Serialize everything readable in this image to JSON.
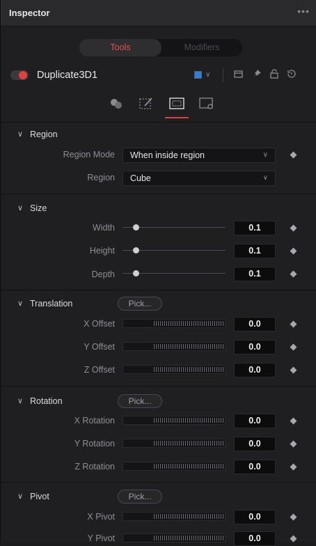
{
  "header": {
    "title": "Inspector",
    "more": "•••"
  },
  "tabs": {
    "tools": "Tools",
    "modifiers": "Modifiers"
  },
  "tool": {
    "name": "Duplicate3D1",
    "color": "#2f7fd6",
    "enabled": true
  },
  "sections": {
    "region": {
      "title": "Region",
      "region_mode_label": "Region Mode",
      "region_mode_value": "When inside region",
      "region_label": "Region",
      "region_value": "Cube"
    },
    "size": {
      "title": "Size",
      "width_label": "Width",
      "width_value": "0.1",
      "height_label": "Height",
      "height_value": "0.1",
      "depth_label": "Depth",
      "depth_value": "0.1"
    },
    "translation": {
      "title": "Translation",
      "pick": "Pick...",
      "x_label": "X Offset",
      "x_value": "0.0",
      "y_label": "Y Offset",
      "y_value": "0.0",
      "z_label": "Z Offset",
      "z_value": "0.0"
    },
    "rotation": {
      "title": "Rotation",
      "pick": "Pick...",
      "x_label": "X Rotation",
      "x_value": "0.0",
      "y_label": "Y Rotation",
      "y_value": "0.0",
      "z_label": "Z Rotation",
      "z_value": "0.0"
    },
    "pivot": {
      "title": "Pivot",
      "pick": "Pick...",
      "x_label": "X Pivot",
      "x_value": "0.0",
      "y_label": "Y Pivot",
      "y_value": "0.0"
    }
  },
  "colors": {
    "accent": "#e0413c",
    "background": "#1f1f21"
  },
  "icons": [
    "more-icon",
    "enable-toggle",
    "color-swatch",
    "chevron-down-icon",
    "window-icon",
    "pin-icon",
    "lock-icon",
    "reset-icon",
    "material-icon",
    "transform-icon",
    "settings-panel-icon",
    "keyframe-icon"
  ]
}
